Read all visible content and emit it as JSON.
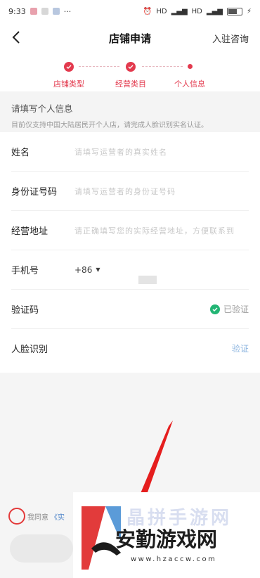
{
  "status_bar": {
    "time": "9:33",
    "dots": "···",
    "hd1": "HD",
    "hd2": "HD",
    "battery": "72"
  },
  "nav": {
    "title": "店铺申请",
    "consult": "入驻咨询"
  },
  "steps": [
    {
      "label": "店铺类型"
    },
    {
      "label": "经营类目"
    },
    {
      "label": "个人信息"
    }
  ],
  "notice": {
    "title": "请填写个人信息",
    "subtitle": "目前仅支持中国大陆居民开个人店，请完成人脸识别实名认证。"
  },
  "form": {
    "name": {
      "label": "姓名",
      "placeholder": "请填写运营者的真实姓名"
    },
    "id_number": {
      "label": "身份证号码",
      "placeholder": "请填写运营者的身份证号码"
    },
    "address": {
      "label": "经营地址",
      "placeholder": "请正确填写您的实际经营地址，方便联系到"
    },
    "phone": {
      "label": "手机号",
      "country_code": "+86"
    },
    "code": {
      "label": "验证码",
      "status": "已验证"
    },
    "face": {
      "label": "人脸识别",
      "action": "验证"
    }
  },
  "agreement": {
    "prefix": "我同意",
    "link": "《实"
  },
  "watermark": {
    "faint": "晶拼手游网",
    "brand": "安勤游戏网",
    "url": "www.hzaccw.com"
  },
  "colors": {
    "accent": "#e33a4e",
    "verified": "#22b574",
    "link": "#8fb6e0"
  }
}
